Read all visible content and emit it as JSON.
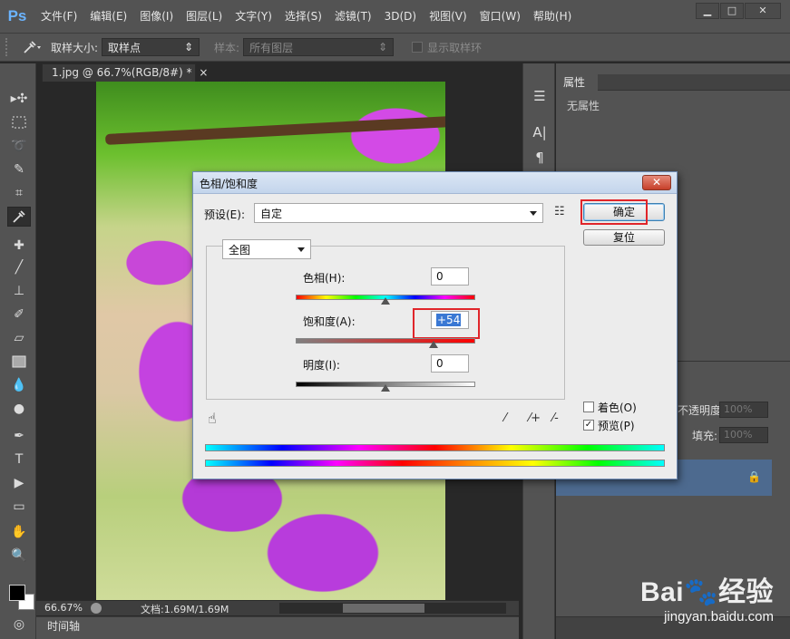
{
  "app": {
    "logo": "Ps"
  },
  "menu": [
    "文件(F)",
    "编辑(E)",
    "图像(I)",
    "图层(L)",
    "文字(Y)",
    "选择(S)",
    "滤镜(T)",
    "3D(D)",
    "视图(V)",
    "窗口(W)",
    "帮助(H)"
  ],
  "window_controls": {
    "minimize": "▁",
    "restore": "□",
    "close": "✕"
  },
  "options_bar": {
    "sample_size_label": "取样大小:",
    "sample_size_value": "取样点",
    "sample_label": "样本:",
    "sample_value": "所有图层",
    "show_ring_label": "显示取样环"
  },
  "document": {
    "tab_title": "1.jpg @ 66.7%(RGB/8#) *",
    "tab_close": "×",
    "zoom": "66.67%",
    "doc_size": "文档:1.69M/1.69M"
  },
  "timeline": {
    "label": "时间轴"
  },
  "properties_panel": {
    "tab": "属性",
    "empty_text": "无属性"
  },
  "layers_panel": {
    "opacity_label": "不透明度:",
    "opacity_value": "100%",
    "fill_label": "填充:",
    "fill_value": "100%"
  },
  "dialog": {
    "title": "色相/饱和度",
    "close": "✕",
    "preset_label": "预设(E):",
    "preset_value": "自定",
    "channel_value": "全图",
    "hue_label": "色相(H):",
    "hue_value": "0",
    "saturation_label": "饱和度(A):",
    "saturation_value": "+54",
    "lightness_label": "明度(I):",
    "lightness_value": "0",
    "ok_button": "确定",
    "reset_button": "复位",
    "colorize_label": "着色(O)",
    "colorize_checked": false,
    "preview_label": "预览(P)",
    "preview_checked": true,
    "sliders": {
      "hue": 0,
      "saturation": 54,
      "lightness": 0
    }
  },
  "watermark": {
    "logo_text": "Bai",
    "logo_text_2": "经验",
    "url": "jingyan.baidu.com"
  }
}
